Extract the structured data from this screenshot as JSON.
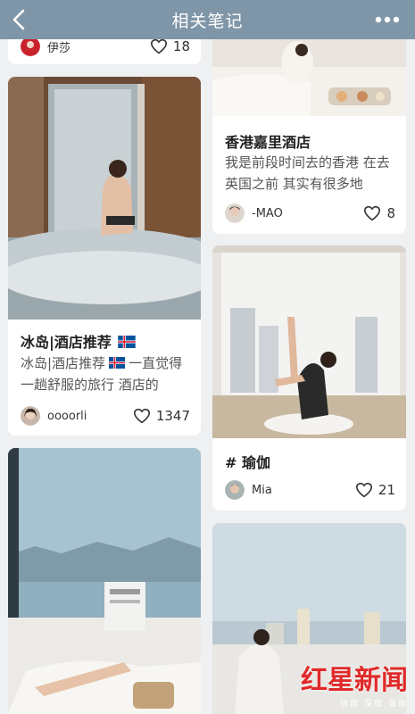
{
  "nav": {
    "title": "相关笔记",
    "back_icon": "chevron-left-icon",
    "more_icon": "more-dots-icon"
  },
  "cards": [
    {
      "id": "top-left-partial",
      "author": "伊莎",
      "likes": "18"
    },
    {
      "id": "top-right",
      "title": "香港嘉里酒店",
      "description": "我是前段时间去的香港 在去英国之前 其实有很多地",
      "author": "-MAO",
      "likes": "8"
    },
    {
      "id": "iceland",
      "title": "冰岛|酒店推荐",
      "description_before_flag": "冰岛|酒店推荐",
      "description_after_flag": "一直觉得一趟舒服的旅行 酒店的",
      "author": "oooorli",
      "likes": "1347"
    },
    {
      "id": "yoga",
      "title": "# 瑜伽",
      "author": "Mia",
      "likes": "21"
    }
  ],
  "watermark": {
    "main": "红星新闻",
    "sub": "锐度 深度 温度"
  },
  "colors": {
    "navbar": "#7f96a8",
    "background": "#eef0f2",
    "watermark_red": "#e02a2a"
  }
}
